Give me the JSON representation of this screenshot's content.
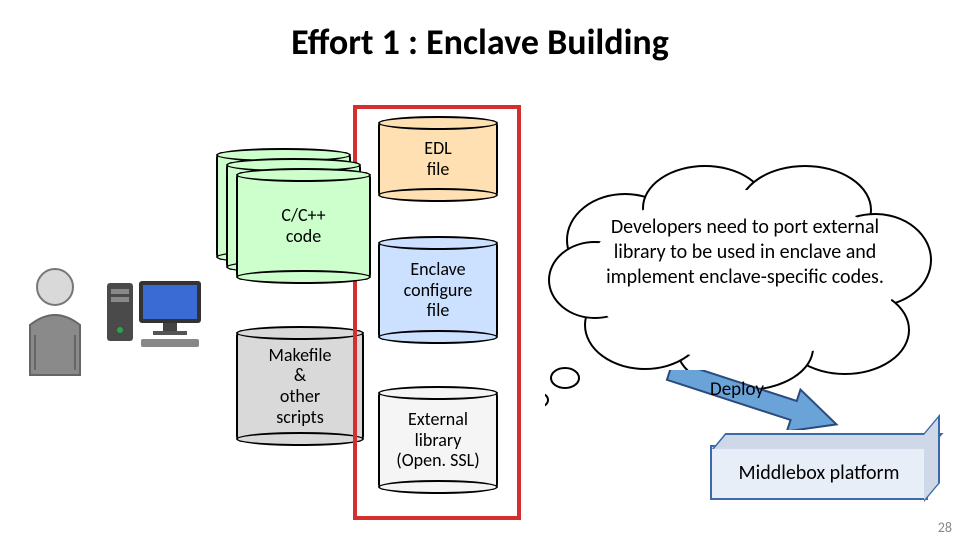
{
  "title": "Effort 1 : Enclave Building",
  "docs": {
    "ccpp": "C/C++\ncode",
    "makefile": "Makefile\n&\nother\nscripts",
    "edl": "EDL\nfile",
    "enclave_cfg": "Enclave\nconfigure\nfile",
    "extlib": "External\nlibrary\n(Open. SSL)"
  },
  "cloud_text": "Developers need to port external library to be used in enclave and implement enclave-specific codes.",
  "deploy_label": "Deploy",
  "platform_label": "Middlebox platform",
  "page_number": "28",
  "colors": {
    "cpp": "#ccffcc",
    "make": "#d9d9d9",
    "edl": "#ffe0b3",
    "cfg": "#cce0ff",
    "lib": "#f5f5f5",
    "red": "#d32f2f",
    "arrow": "#6aa3d8"
  }
}
